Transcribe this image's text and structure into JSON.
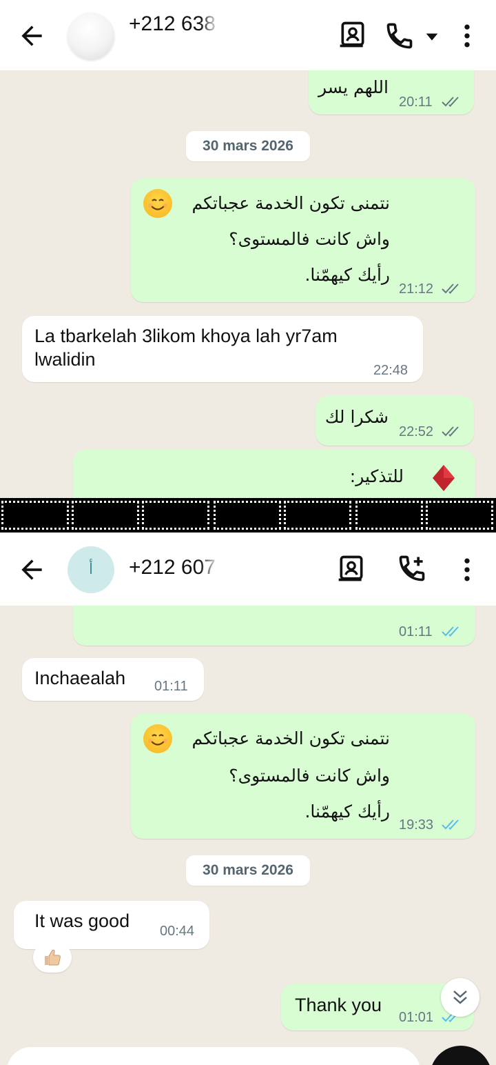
{
  "panel1": {
    "header": {
      "phone": "+212 638",
      "icons": [
        "back-arrow-icon",
        "contact-card-icon",
        "phone-call-icon",
        "caret-down-icon",
        "more-vertical-icon"
      ]
    },
    "messages": [
      {
        "dir": "out",
        "text": "اللهم يسر",
        "time": "20:11",
        "status": "read"
      },
      {
        "type": "date",
        "text": "30 mars 2026"
      },
      {
        "dir": "out",
        "lines": [
          "نتمنى تكون الخدمة عجباتكم",
          "واش كانت فالمستوى؟",
          "رأيك كيهمّنا."
        ],
        "emoji": "smiling-face-emoji",
        "time": "21:12",
        "status": "read"
      },
      {
        "dir": "in",
        "lines": [
          "La tbarkelah 3likom khoya lah yr7am",
          "lwalidin"
        ],
        "time": "22:48"
      },
      {
        "dir": "out",
        "text": "شكرا لك",
        "time": "22:52",
        "status": "read"
      },
      {
        "dir": "out",
        "text": "للتذكير:",
        "emoji": "red-diamond-emoji"
      }
    ]
  },
  "panel2": {
    "header": {
      "phone": "+212 607",
      "avatar_letter": "أ",
      "icons": [
        "back-arrow-icon",
        "contact-card-icon",
        "add-call-icon",
        "more-vertical-icon"
      ]
    },
    "messages": [
      {
        "dir": "out",
        "text": "",
        "time": "01:11",
        "status": "read"
      },
      {
        "dir": "in",
        "text": "Inchaealah",
        "time": "01:11"
      },
      {
        "dir": "out",
        "lines": [
          "نتمنى تكون الخدمة عجباتكم",
          "واش كانت فالمستوى؟",
          "رأيك كيهمّنا."
        ],
        "emoji": "smiling-face-emoji",
        "time": "19:33",
        "status": "read"
      },
      {
        "type": "date",
        "text": "30 mars 2026"
      },
      {
        "dir": "in",
        "text": "It was good",
        "time": "00:44",
        "reaction": "👍🏼"
      },
      {
        "dir": "out",
        "text": "Thank you",
        "time": "01:01",
        "status": "read"
      }
    ]
  },
  "colors": {
    "chat_bg": "#efeae2",
    "outgoing_bubble": "#d9fdd3",
    "incoming_bubble": "#ffffff",
    "read_tick": "#53bdeb",
    "delivered_tick": "#667781",
    "header_bg": "#ffffff"
  }
}
